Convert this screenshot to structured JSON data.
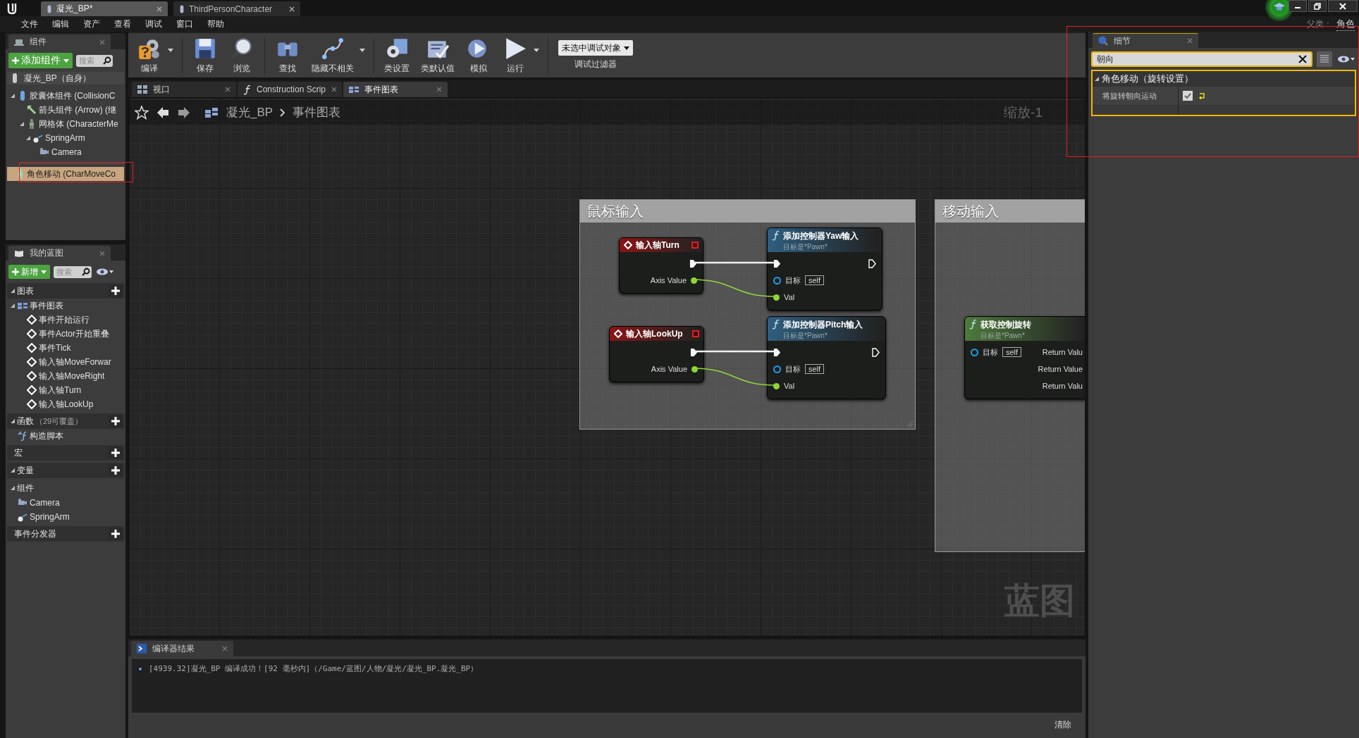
{
  "tabs": [
    {
      "label": "凝光_BP*",
      "selected": true
    },
    {
      "label": "ThirdPersonCharacter",
      "selected": false
    }
  ],
  "menu": [
    "文件",
    "编辑",
    "资产",
    "查看",
    "调试",
    "窗口",
    "帮助"
  ],
  "parent_class": {
    "label": "父类：",
    "value": "角色"
  },
  "components_panel": {
    "title": "组件",
    "add_button": "添加组件",
    "search_placeholder": "搜索",
    "self": "凝光_BP（自身）",
    "tree": [
      {
        "label": "胶囊体组件 (CollisionC",
        "kind": "capsule",
        "expanded": true,
        "children": [
          {
            "label": "箭头组件 (Arrow) (继",
            "kind": "arrow"
          },
          {
            "label": "网格体 (CharacterMe",
            "kind": "mesh",
            "expanded": true,
            "children": [
              {
                "label": "SpringArm",
                "kind": "springarm",
                "expanded": true,
                "children": [
                  {
                    "label": "Camera",
                    "kind": "camera"
                  }
                ]
              }
            ]
          }
        ]
      }
    ],
    "movement": {
      "label": "角色移动 (CharMoveCo",
      "selected": true
    }
  },
  "toolbar": [
    {
      "label": "编译",
      "kind": "compile",
      "dropdown": true
    },
    {
      "label": "保存",
      "kind": "save",
      "dropdown": false
    },
    {
      "label": "浏览",
      "kind": "browse",
      "dropdown": false
    },
    {
      "label": "查找",
      "kind": "find",
      "dropdown": false
    },
    {
      "label": "隐藏不相关",
      "kind": "hide",
      "dropdown": true
    },
    {
      "label": "类设置",
      "kind": "settings",
      "dropdown": false
    },
    {
      "label": "类默认值",
      "kind": "defaults",
      "dropdown": false
    },
    {
      "label": "模拟",
      "kind": "simulate",
      "dropdown": false
    },
    {
      "label": "运行",
      "kind": "play",
      "dropdown": true
    }
  ],
  "debug_filter": {
    "value": "未选中调试对象",
    "label": "调试过滤器"
  },
  "editor_tabs": [
    {
      "label": "视口",
      "kind": "viewport",
      "selected": false
    },
    {
      "label": "Construction Scrip",
      "kind": "function",
      "selected": false
    },
    {
      "label": "事件图表",
      "kind": "graph",
      "selected": true
    }
  ],
  "breadcrumb": [
    "凝光_BP",
    "事件图表"
  ],
  "zoom_label": "缩放-1",
  "graph_label": "蓝图",
  "comments": [
    {
      "title": "鼠标输入"
    },
    {
      "title": "移动输入"
    }
  ],
  "nodes": [
    {
      "kind": "event",
      "title": "输入轴Turn",
      "pins": [
        "Axis Value"
      ]
    },
    {
      "kind": "function",
      "title": "添加控制器Yaw输入",
      "subtitle": "目标是*Pawn*",
      "target": "目标",
      "self": "self",
      "pins": [
        "Val"
      ]
    },
    {
      "kind": "event",
      "title": "输入轴LookUp",
      "pins": [
        "Axis Value"
      ]
    },
    {
      "kind": "function",
      "title": "添加控制器Pitch输入",
      "subtitle": "目标是*Pawn*",
      "target": "目标",
      "self": "self",
      "pins": [
        "Val"
      ]
    },
    {
      "kind": "pure",
      "title": "获取控制旋转",
      "subtitle": "目标是*Pawn*",
      "target": "目标",
      "self": "self",
      "pins": [
        "Return Valu",
        "Return Value",
        "Return Valu"
      ]
    }
  ],
  "my_blueprint": {
    "title": "我的蓝图",
    "add_button": "新增",
    "search_placeholder": "搜索",
    "sections": [
      {
        "title": "图表",
        "kind": "category",
        "expanded": true,
        "items": [
          {
            "label": "事件图表",
            "kind": "graph",
            "expanded": true,
            "children": [
              {
                "label": "事件开始运行",
                "kind": "event"
              },
              {
                "label": "事件Actor开始重叠",
                "kind": "event"
              },
              {
                "label": "事件Tick",
                "kind": "event"
              },
              {
                "label": "输入轴MoveForwar",
                "kind": "event"
              },
              {
                "label": "输入轴MoveRight",
                "kind": "event"
              },
              {
                "label": "输入轴Turn",
                "kind": "event"
              },
              {
                "label": "输入轴LookUp",
                "kind": "event"
              }
            ]
          }
        ]
      },
      {
        "title": "函数",
        "note": "（29可覆盖）",
        "kind": "category",
        "expanded": true,
        "items": [
          {
            "label": "构造脚本",
            "kind": "function"
          }
        ]
      },
      {
        "title": "宏",
        "kind": "category"
      },
      {
        "title": "变量",
        "kind": "category",
        "expanded": true
      },
      {
        "title": "组件",
        "kind": "group",
        "expanded": true,
        "items": [
          {
            "label": "Camera",
            "kind": "camera"
          },
          {
            "label": "SpringArm",
            "kind": "springarm"
          }
        ]
      },
      {
        "title": "事件分发器",
        "kind": "category"
      }
    ]
  },
  "details": {
    "title": "细节",
    "search_value": "朝向",
    "category": "角色移动（旋转设置）",
    "expanded": true,
    "properties": [
      {
        "label": "将旋转朝向运动",
        "checked": true
      }
    ]
  },
  "compiler": {
    "title": "编译器结果",
    "lines": [
      "[4939.32]凝光_BP 编译成功！[92 毫秒内]（/Game/蓝图/人物/凝光/凝光_BP.凝光_BP）"
    ],
    "clear": "清除"
  }
}
